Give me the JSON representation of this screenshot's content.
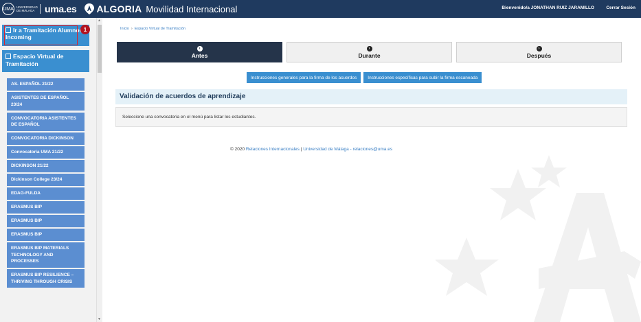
{
  "header": {
    "uni_seal": "UMA",
    "uni_name_line1": "UNIVERSIDAD",
    "uni_name_line2": "DE MÁLAGA",
    "portal": "uma.es",
    "brand": "ALGORIA",
    "app_title": "Movilidad Internacional",
    "welcome": "Bienvenido/a JONATHAN RUIZ JARAMILLO",
    "logout": "Cerrar Sesión"
  },
  "sidebar": {
    "top_button": "Ir a Tramitación Alumnos Incoming",
    "badge": "1",
    "section": "Espacio Virtual de Tramitación",
    "items": [
      "AS. ESPAÑOL 21/22",
      "ASISTENTES DE ESPAÑOL 23/24",
      "CONVOCATORIA ASISTENTES DE ESPAÑOL",
      "CONVOCATORIA DICKINSON",
      "Convocatoria UMA 21/22",
      "DICKINSON 21/22",
      "Dickinson College 23/24",
      "EDAG-FULDA",
      "ERASMUS BIP",
      "ERASMUS BIP",
      "ERASMUS BIP",
      "ERASMUS BIP MATERIALS TECHNOLOGY AND PROCESSES",
      "ERASMUS BIP RESILIENCE – THRIVING THROUGH CRISIS"
    ]
  },
  "breadcrumb": {
    "home": "Inicio",
    "current": "Espacio Virtual de Tramitación"
  },
  "steps": [
    {
      "label": "Antes",
      "active": true
    },
    {
      "label": "Durante",
      "active": false
    },
    {
      "label": "Después",
      "active": false
    }
  ],
  "buttons": {
    "general": "Instrucciones generales para la firma de los acuerdos",
    "specific": "Instrucciones específicas para subir la firma escaneada"
  },
  "panel": {
    "title": "Validación de acuerdos de aprendizaje",
    "message": "Seleccione una convocatoria en el menú para listar los estudiantes."
  },
  "footer": {
    "copyright": "© 2020",
    "link1": "Relaciones Internacionales",
    "sep": "|",
    "link2": "Universidad de Málaga - relaciones@uma.es"
  },
  "colors": {
    "header_bg": "#1f3a5f",
    "primary": "#3a8fd0",
    "sidebar_item": "#5b8ed1",
    "active_step": "#25344a",
    "highlight": "#d9232d"
  }
}
